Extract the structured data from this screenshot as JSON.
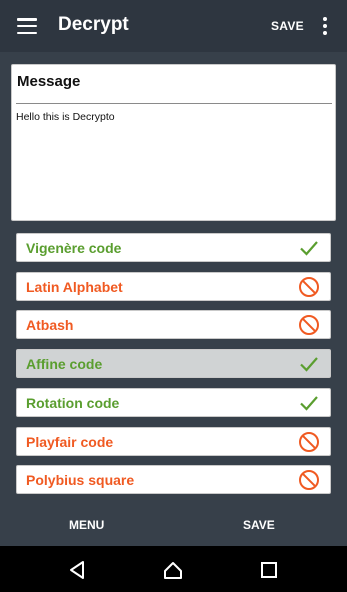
{
  "appbar": {
    "title": "Decrypt",
    "save_label": "SAVE",
    "menu_icon": "hamburger-menu-icon",
    "overflow_icon": "more-vert-icon"
  },
  "message": {
    "label": "Message",
    "text": "Hello this is Decrypto"
  },
  "codes": [
    {
      "label": "Vigenère code",
      "status": "valid",
      "selected": false
    },
    {
      "label": "Latin Alphabet",
      "status": "invalid",
      "selected": false
    },
    {
      "label": "Atbash",
      "status": "invalid",
      "selected": false
    },
    {
      "label": "Affine code",
      "status": "valid",
      "selected": true
    },
    {
      "label": "Rotation code",
      "status": "valid",
      "selected": false
    },
    {
      "label": "Playfair code",
      "status": "invalid",
      "selected": false
    },
    {
      "label": "Polybius square",
      "status": "invalid",
      "selected": false
    }
  ],
  "bottom": {
    "menu_label": "MENU",
    "save_label": "SAVE"
  },
  "colors": {
    "valid": "#5a9e2f",
    "invalid": "#f05a22",
    "appbar": "#2e3640",
    "background": "#37404a"
  },
  "navbar": {
    "back_icon": "back-icon",
    "home_icon": "home-icon",
    "recents_icon": "recents-icon"
  }
}
